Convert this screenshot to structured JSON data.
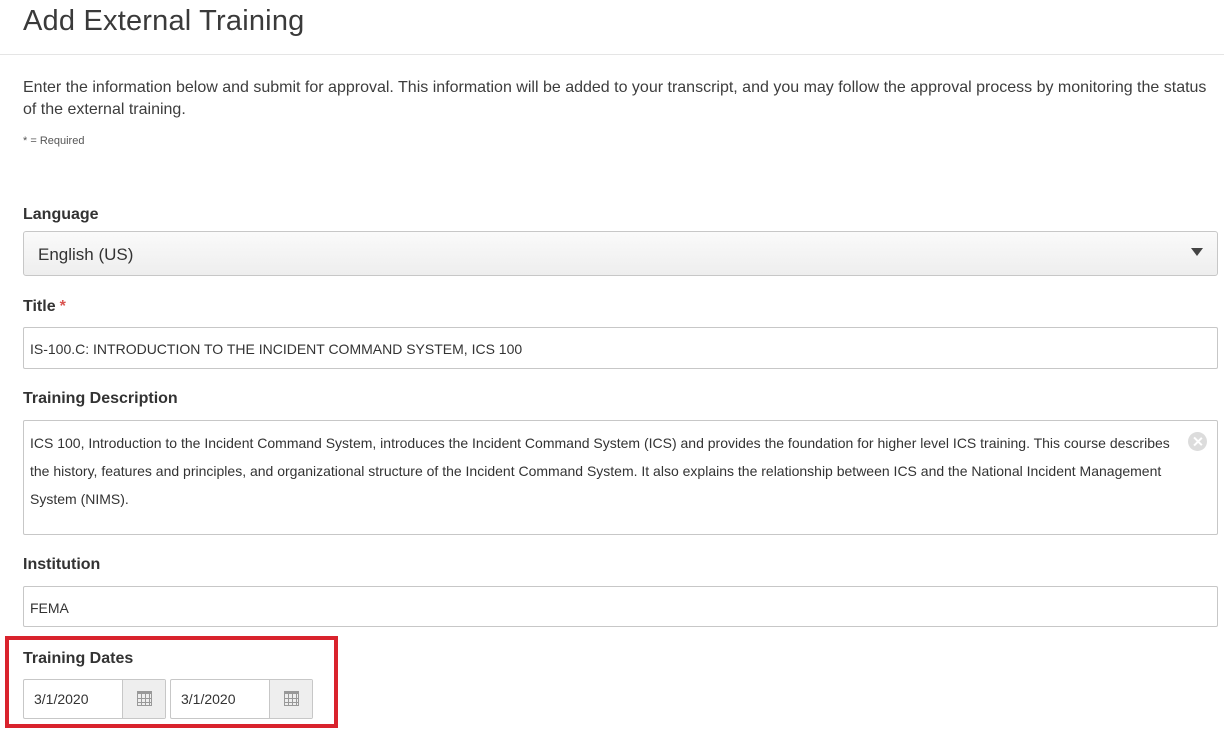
{
  "page": {
    "title": "Add External Training",
    "intro": "Enter the information below and submit for approval. This information will be added to your transcript, and you may follow the approval process by monitoring the status of the external training.",
    "required_note": "* = Required"
  },
  "form": {
    "language": {
      "label": "Language",
      "value": "English (US)"
    },
    "title": {
      "label": "Title",
      "required_mark": "*",
      "value": "IS-100.C: INTRODUCTION TO THE INCIDENT COMMAND SYSTEM, ICS 100"
    },
    "description": {
      "label": "Training Description",
      "value": "ICS 100, Introduction to the Incident Command System, introduces the Incident Command System (ICS) and provides the foundation for higher level ICS training. This course describes the history, features and principles, and organizational structure of the Incident Command System. It also explains the relationship between ICS and the National Incident Management System (NIMS)."
    },
    "institution": {
      "label": "Institution",
      "value": "FEMA"
    },
    "training_dates": {
      "label": "Training Dates",
      "start": "3/1/2020",
      "end": "3/1/2020"
    }
  },
  "colors": {
    "highlight": "#d9232d",
    "required": "#d9534f"
  },
  "icons": {
    "dropdown": "caret-down-icon",
    "clear": "clear-icon",
    "calendar": "calendar-icon"
  }
}
